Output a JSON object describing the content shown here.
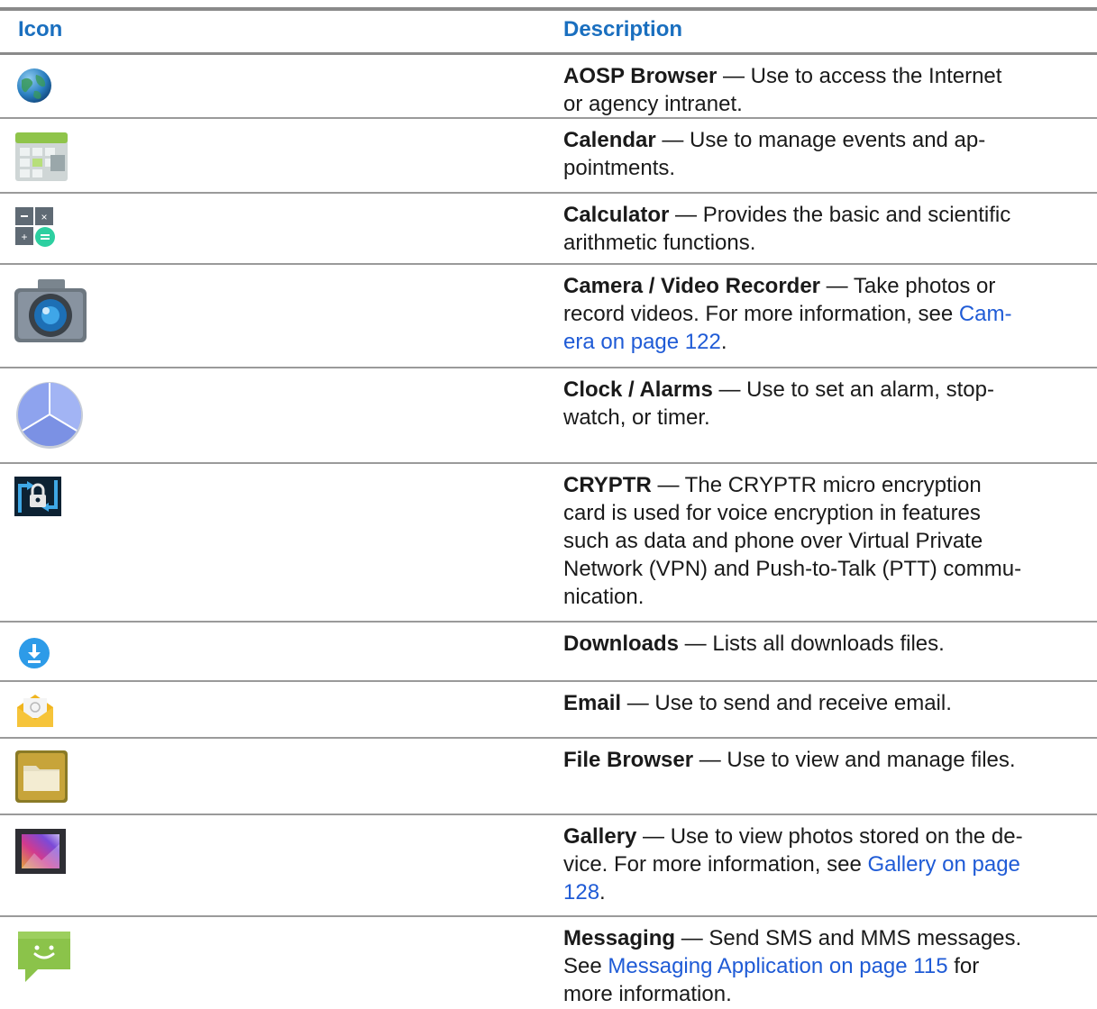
{
  "header": {
    "icon": "Icon",
    "description": "Description"
  },
  "rows": [
    {
      "icon": "globe-icon",
      "title": "AOSP Browser",
      "line1": " — Use to access the Internet",
      "line2": "or agency intranet."
    },
    {
      "icon": "calendar-icon",
      "title": "Calendar",
      "line1": " — Use to manage events and ap-",
      "line2": "pointments."
    },
    {
      "icon": "calculator-icon",
      "title": "Calculator",
      "line1": " — Provides the basic and scientific",
      "line2": "arithmetic functions."
    },
    {
      "icon": "camera-icon",
      "title": "Camera / Video Recorder",
      "line1": " — Take photos or",
      "line2": "record videos. For more information, see ",
      "link_a": "Cam-",
      "link_b": "era on page 122",
      "line3_end": "."
    },
    {
      "icon": "clock-icon",
      "title": "Clock / Alarms",
      "line1": " — Use to set an alarm, stop-",
      "line2": "watch, or timer."
    },
    {
      "icon": "lock-icon",
      "title": "CRYPTR",
      "line1": " — The CRYPTR micro encryption",
      "line2": "card is used for voice encryption in features",
      "line3": "such as data and phone over Virtual Private",
      "line4": "Network (VPN) and Push-to-Talk (PTT) commu-",
      "line5": "nication."
    },
    {
      "icon": "download-icon",
      "title": "Downloads",
      "line1": " — Lists all downloads files."
    },
    {
      "icon": "email-icon",
      "title": "Email",
      "line1": " — Use to send and receive email."
    },
    {
      "icon": "folder-icon",
      "title": "File Browser",
      "line1": " — Use to view and manage files."
    },
    {
      "icon": "gallery-icon",
      "title": "Gallery",
      "line1": " — Use to view photos stored on the de-",
      "line2": "vice. For more information, see ",
      "link_a": "Gallery on page",
      "link_b": "128",
      "line3_end": "."
    },
    {
      "icon": "message-icon",
      "title": "Messaging",
      "line1": " — Send SMS and MMS messages.",
      "line2": "See ",
      "link_a": "Messaging Application on page 115",
      "line2_end": " for",
      "line3": "more information."
    }
  ],
  "colors": {
    "header_text": "#1a6fbf",
    "link": "#1f5bd6",
    "rule": "#8a8a8a"
  }
}
